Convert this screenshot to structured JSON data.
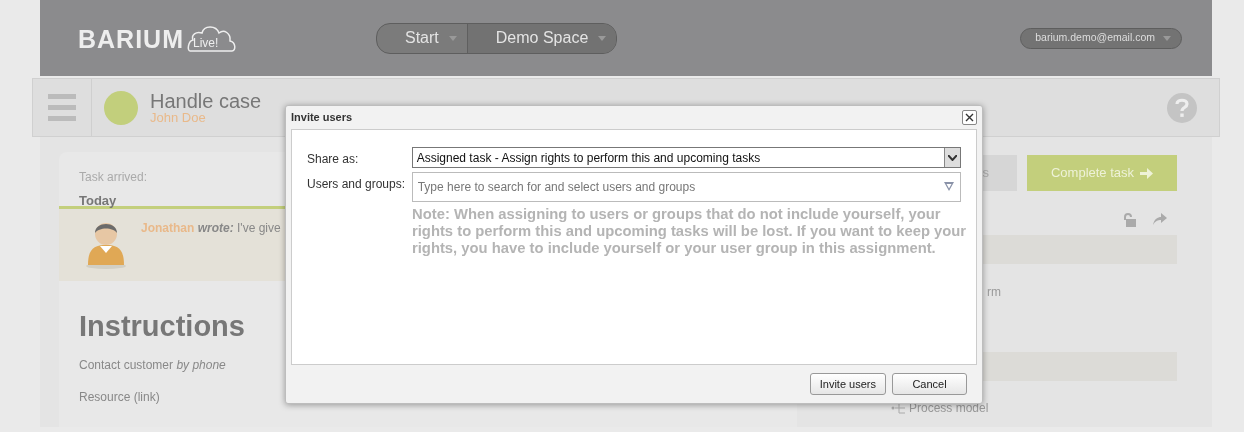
{
  "header": {
    "logo": {
      "name": "BARIUM",
      "badge": "Live!"
    },
    "nav": [
      {
        "label": "Start"
      },
      {
        "label": "Demo Space"
      }
    ],
    "user": "barium.demo@email.com"
  },
  "task_bar": {
    "title": "Handle case",
    "subtitle": "John Doe"
  },
  "task": {
    "arrived_label": "Task arrived:",
    "arrived_value": "Today",
    "comment": {
      "author": "Jonathan",
      "verb": "wrote:",
      "text": "I've give"
    },
    "heading": "Instructions",
    "lines": [
      "Contact customer *by phone*",
      "Resource (link)"
    ]
  },
  "side": {
    "buttons": [
      {
        "label": "s",
        "kind": "secondary"
      },
      {
        "label": "Complete task",
        "kind": "primary"
      }
    ],
    "link_text": "rm",
    "process_link": "Process model"
  },
  "dialog": {
    "title": "Invite users",
    "share_as": {
      "label": "Share as:",
      "value": "Assigned task - Assign rights to perform this and upcoming tasks"
    },
    "users": {
      "label": "Users and groups:",
      "placeholder": "Type here to search for and select users and groups"
    },
    "note": "Note: When assigning to users or groups that do not include yourself, your rights to perform this and upcoming tasks will be lost. If you want to keep your rights, you have to include yourself or your user group in this assignment.",
    "buttons": [
      "Invite users",
      "Cancel"
    ]
  }
}
